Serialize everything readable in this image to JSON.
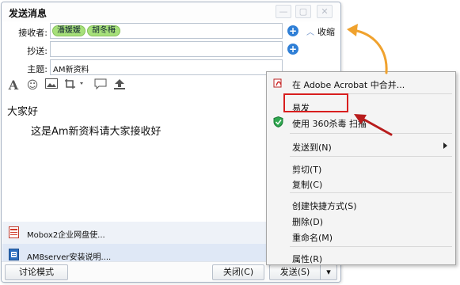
{
  "window": {
    "title": "发送消息",
    "controls": [
      "minimize-icon",
      "restore-icon",
      "close-icon"
    ]
  },
  "recipients": {
    "label": "接收者:",
    "chips": [
      "潘媛媛",
      "胡冬梅"
    ],
    "add_icon": "plus-icon",
    "collapse_label": "收缩"
  },
  "cc": {
    "label": "抄送:",
    "add_icon": "plus-icon"
  },
  "subject": {
    "label": "主题:",
    "value": "AM新资料"
  },
  "toolbar": [
    "font-icon",
    "emoji-icon",
    "image-icon",
    "screenshot-icon",
    "chat-bubble-icon",
    "upload-icon"
  ],
  "message": {
    "line1": "大家好",
    "line2": "这是Am新资料请大家接收好"
  },
  "attachments": [
    {
      "name": "Mobox2企业网盘使...",
      "icon": "pdf-file-icon"
    },
    {
      "name": "AM8server安装说明....",
      "icon": "doc-file-icon"
    }
  ],
  "buttons": {
    "discuss": "讨论模式",
    "close": "关闭(C)",
    "send": "发送(S)",
    "send_dropdown_icon": "dropdown-arrow-icon"
  },
  "context_menu": {
    "items": [
      {
        "label": "在 Adobe Acrobat 中合并...",
        "icon": "acrobat-icon"
      },
      {
        "label": "易发"
      },
      {
        "label": "使用 360杀毒 扫描",
        "icon": "shield-icon"
      },
      {
        "label": "发送到(N)",
        "submenu": true
      },
      {
        "label": "剪切(T)"
      },
      {
        "label": "复制(C)"
      },
      {
        "label": "创建快捷方式(S)"
      },
      {
        "label": "删除(D)"
      },
      {
        "label": "重命名(M)"
      },
      {
        "label": "属性(R)"
      }
    ]
  },
  "annotation_colors": {
    "highlight": "#d81e1e",
    "orange_arrow": "#f0a22e",
    "red_arrow": "#b81c1c"
  }
}
